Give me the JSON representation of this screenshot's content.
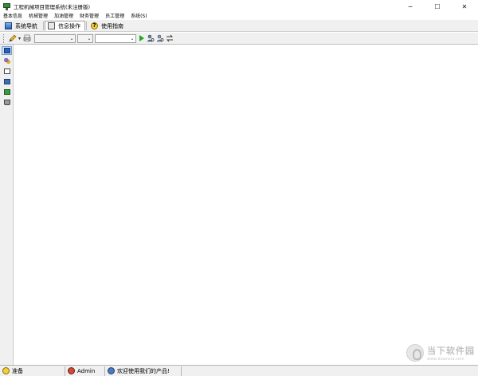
{
  "window": {
    "title": "工程机械项目管理系统(未注册版)",
    "controls": {
      "minimize": "─",
      "maximize": "☐",
      "close": "✕"
    }
  },
  "menu": {
    "items": [
      "基本信息",
      "机械管理",
      "加油管理",
      "财务管理",
      "员工管理",
      "系统(S)"
    ]
  },
  "tabs": [
    {
      "label": "系统导航",
      "icon": "navigation-icon"
    },
    {
      "label": "信息操作",
      "icon": "info-panel-icon",
      "active": true
    },
    {
      "label": "使用指南",
      "icon": "help-icon"
    }
  ],
  "toolbar": {
    "combo1_value": "",
    "combo2_value": "",
    "icons": [
      "pencil-icon",
      "printer-icon",
      "run-icon",
      "find-user-icon",
      "search-user-icon",
      "refresh-icon"
    ]
  },
  "sidebar": {
    "icons": [
      "monitor-icon",
      "users-icon",
      "list-icon",
      "document-icon",
      "chart-icon",
      "trash-icon"
    ]
  },
  "status": {
    "ready": "准备",
    "user": "Admin",
    "welcome": "欢迎使用我们的产品!"
  },
  "watermark": {
    "title": "当下软件园",
    "url": "www.downxia.com"
  },
  "colors": {
    "accent": "#2a62b8",
    "play": "#1ea81e"
  }
}
